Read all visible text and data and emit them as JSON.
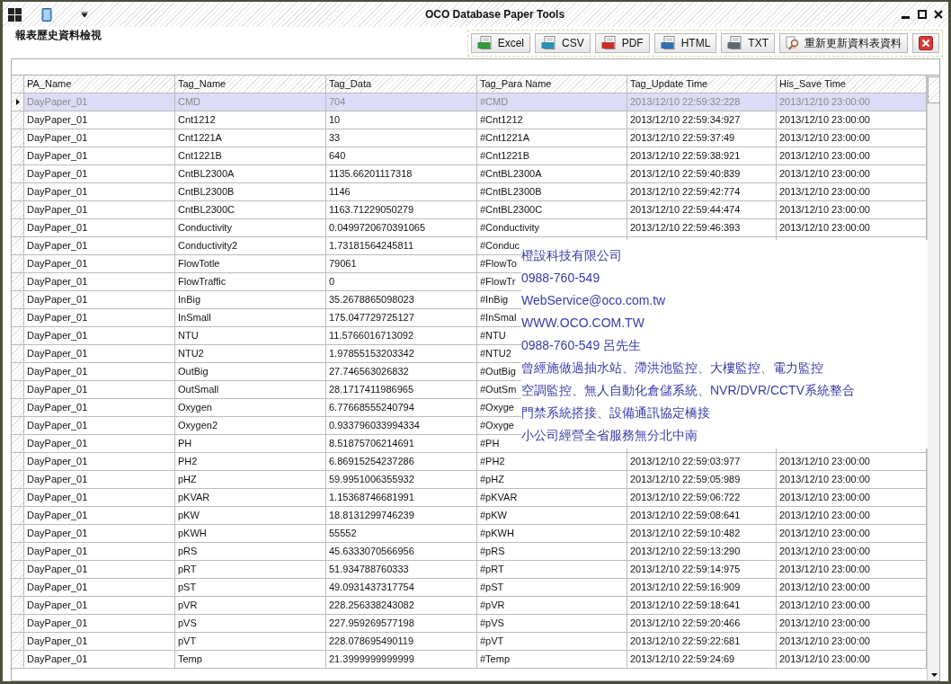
{
  "window": {
    "title": "OCO Database Paper Tools"
  },
  "panel_title": "報表歷史資料檢視",
  "toolbar": [
    {
      "label": "Excel",
      "kind": "xls"
    },
    {
      "label": "CSV",
      "kind": "csv"
    },
    {
      "label": "PDF",
      "kind": "pdf"
    },
    {
      "label": "HTML",
      "kind": "htm"
    },
    {
      "label": "TXT",
      "kind": "txt"
    },
    {
      "label": "重新更新資料表資料",
      "kind": "refresh"
    },
    {
      "kind": "close"
    }
  ],
  "table": {
    "columns": [
      "PA_Name",
      "Tag_Name",
      "Tag_Data",
      "Tag_Para Name",
      "Tag_Update Time",
      "His_Save Time"
    ],
    "rows": [
      {
        "selected": true,
        "cells": [
          "DayPaper_01",
          "CMD",
          "704",
          "#CMD",
          "2013/12/10 22:59:32:228",
          "2013/12/10 23:00:00"
        ]
      },
      {
        "selected": false,
        "cells": [
          "DayPaper_01",
          "Cnt1212",
          "10",
          "#Cnt1212",
          "2013/12/10 22:59:34:927",
          "2013/12/10 23:00:00"
        ]
      },
      {
        "selected": false,
        "cells": [
          "DayPaper_01",
          "Cnt1221A",
          "33",
          "#Cnt1221A",
          "2013/12/10 22:59:37:49",
          "2013/12/10 23:00:00"
        ]
      },
      {
        "selected": false,
        "cells": [
          "DayPaper_01",
          "Cnt1221B",
          "640",
          "#Cnt1221B",
          "2013/12/10 22:59:38:921",
          "2013/12/10 23:00:00"
        ]
      },
      {
        "selected": false,
        "cells": [
          "DayPaper_01",
          "CntBL2300A",
          "1135.66201117318",
          "#CntBL2300A",
          "2013/12/10 22:59:40:839",
          "2013/12/10 23:00:00"
        ]
      },
      {
        "selected": false,
        "cells": [
          "DayPaper_01",
          "CntBL2300B",
          "1146",
          "#CntBL2300B",
          "2013/12/10 22:59:42:774",
          "2013/12/10 23:00:00"
        ]
      },
      {
        "selected": false,
        "cells": [
          "DayPaper_01",
          "CntBL2300C",
          "1163.71229050279",
          "#CntBL2300C",
          "2013/12/10 22:59:44:474",
          "2013/12/10 23:00:00"
        ]
      },
      {
        "selected": false,
        "cells": [
          "DayPaper_01",
          "Conductivity",
          "0.0499720670391065",
          "#Conductivity",
          "2013/12/10 22:59:46:393",
          "2013/12/10 23:00:00"
        ]
      },
      {
        "selected": false,
        "cells": [
          "DayPaper_01",
          "Conductivity2",
          "1.73181564245811",
          "#Conduc"
        ]
      },
      {
        "selected": false,
        "cells": [
          "DayPaper_01",
          "FlowTotle",
          "79061",
          "#FlowTo"
        ]
      },
      {
        "selected": false,
        "cells": [
          "DayPaper_01",
          "FlowTraffic",
          "0",
          "#FlowTr"
        ]
      },
      {
        "selected": false,
        "cells": [
          "DayPaper_01",
          "InBig",
          "35.2678865098023",
          "#InBig"
        ]
      },
      {
        "selected": false,
        "cells": [
          "DayPaper_01",
          "InSmall",
          "175.047729725127",
          "#InSmal"
        ]
      },
      {
        "selected": false,
        "cells": [
          "DayPaper_01",
          "NTU",
          "11.5766016713092",
          "#NTU"
        ]
      },
      {
        "selected": false,
        "cells": [
          "DayPaper_01",
          "NTU2",
          "1.97855153203342",
          "#NTU2"
        ]
      },
      {
        "selected": false,
        "cells": [
          "DayPaper_01",
          "OutBig",
          "27.746563026832",
          "#OutBig"
        ]
      },
      {
        "selected": false,
        "cells": [
          "DayPaper_01",
          "OutSmall",
          "28.1717411986965",
          "#OutSm"
        ]
      },
      {
        "selected": false,
        "cells": [
          "DayPaper_01",
          "Oxygen",
          "6.77668555240794",
          "#Oxyge"
        ]
      },
      {
        "selected": false,
        "cells": [
          "DayPaper_01",
          "Oxygen2",
          "0.933796033994334",
          "#Oxyge"
        ]
      },
      {
        "selected": false,
        "cells": [
          "DayPaper_01",
          "PH",
          "8.51875706214691",
          "#PH"
        ]
      },
      {
        "selected": false,
        "cells": [
          "DayPaper_01",
          "PH2",
          "6.86915254237286",
          "#PH2",
          "2013/12/10 22:59:03:977",
          "2013/12/10 23:00:00"
        ]
      },
      {
        "selected": false,
        "cells": [
          "DayPaper_01",
          "pHZ",
          "59.9951006355932",
          "#pHZ",
          "2013/12/10 22:59:05:989",
          "2013/12/10 23:00:00"
        ]
      },
      {
        "selected": false,
        "cells": [
          "DayPaper_01",
          "pKVAR",
          "1.15368746681991",
          "#pKVAR",
          "2013/12/10 22:59:06:722",
          "2013/12/10 23:00:00"
        ]
      },
      {
        "selected": false,
        "cells": [
          "DayPaper_01",
          "pKW",
          "18.8131299746239",
          "#pKW",
          "2013/12/10 22:59:08:641",
          "2013/12/10 23:00:00"
        ]
      },
      {
        "selected": false,
        "cells": [
          "DayPaper_01",
          "pKWH",
          "55552",
          "#pKWH",
          "2013/12/10 22:59:10:482",
          "2013/12/10 23:00:00"
        ]
      },
      {
        "selected": false,
        "cells": [
          "DayPaper_01",
          "pRS",
          "45.6333070566956",
          "#pRS",
          "2013/12/10 22:59:13:290",
          "2013/12/10 23:00:00"
        ]
      },
      {
        "selected": false,
        "cells": [
          "DayPaper_01",
          "pRT",
          "51.934788760333",
          "#pRT",
          "2013/12/10 22:59:14:975",
          "2013/12/10 23:00:00"
        ]
      },
      {
        "selected": false,
        "cells": [
          "DayPaper_01",
          "pST",
          "49.0931437317754",
          "#pST",
          "2013/12/10 22:59:16:909",
          "2013/12/10 23:00:00"
        ]
      },
      {
        "selected": false,
        "cells": [
          "DayPaper_01",
          "pVR",
          "228.256338243082",
          "#pVR",
          "2013/12/10 22:59:18:641",
          "2013/12/10 23:00:00"
        ]
      },
      {
        "selected": false,
        "cells": [
          "DayPaper_01",
          "pVS",
          "227.959269577198",
          "#pVS",
          "2013/12/10 22:59:20:466",
          "2013/12/10 23:00:00"
        ]
      },
      {
        "selected": false,
        "cells": [
          "DayPaper_01",
          "pVT",
          "228.078695490119",
          "#pVT",
          "2013/12/10 22:59:22:681",
          "2013/12/10 23:00:00"
        ]
      },
      {
        "selected": false,
        "cells": [
          "DayPaper_01",
          "Temp",
          "21.3999999999999",
          "#Temp",
          "2013/12/10 22:59:24:69",
          "2013/12/10 23:00:00"
        ]
      }
    ]
  },
  "overlay": {
    "lines": [
      "橙設科技有限公司",
      "0988-760-549",
      "WebService@oco.com.tw",
      "WWW.OCO.COM.TW",
      "0988-760-549 呂先生",
      "曾經施做過抽水站、滯洪池監控、大樓監控、電力監控",
      "空調監控、無人自動化倉儲系統、NVR/DVR/CCTV系統整合",
      "門禁系統搭接、設備通訊協定橋接",
      "小公司經營全省服務無分北中南"
    ]
  }
}
